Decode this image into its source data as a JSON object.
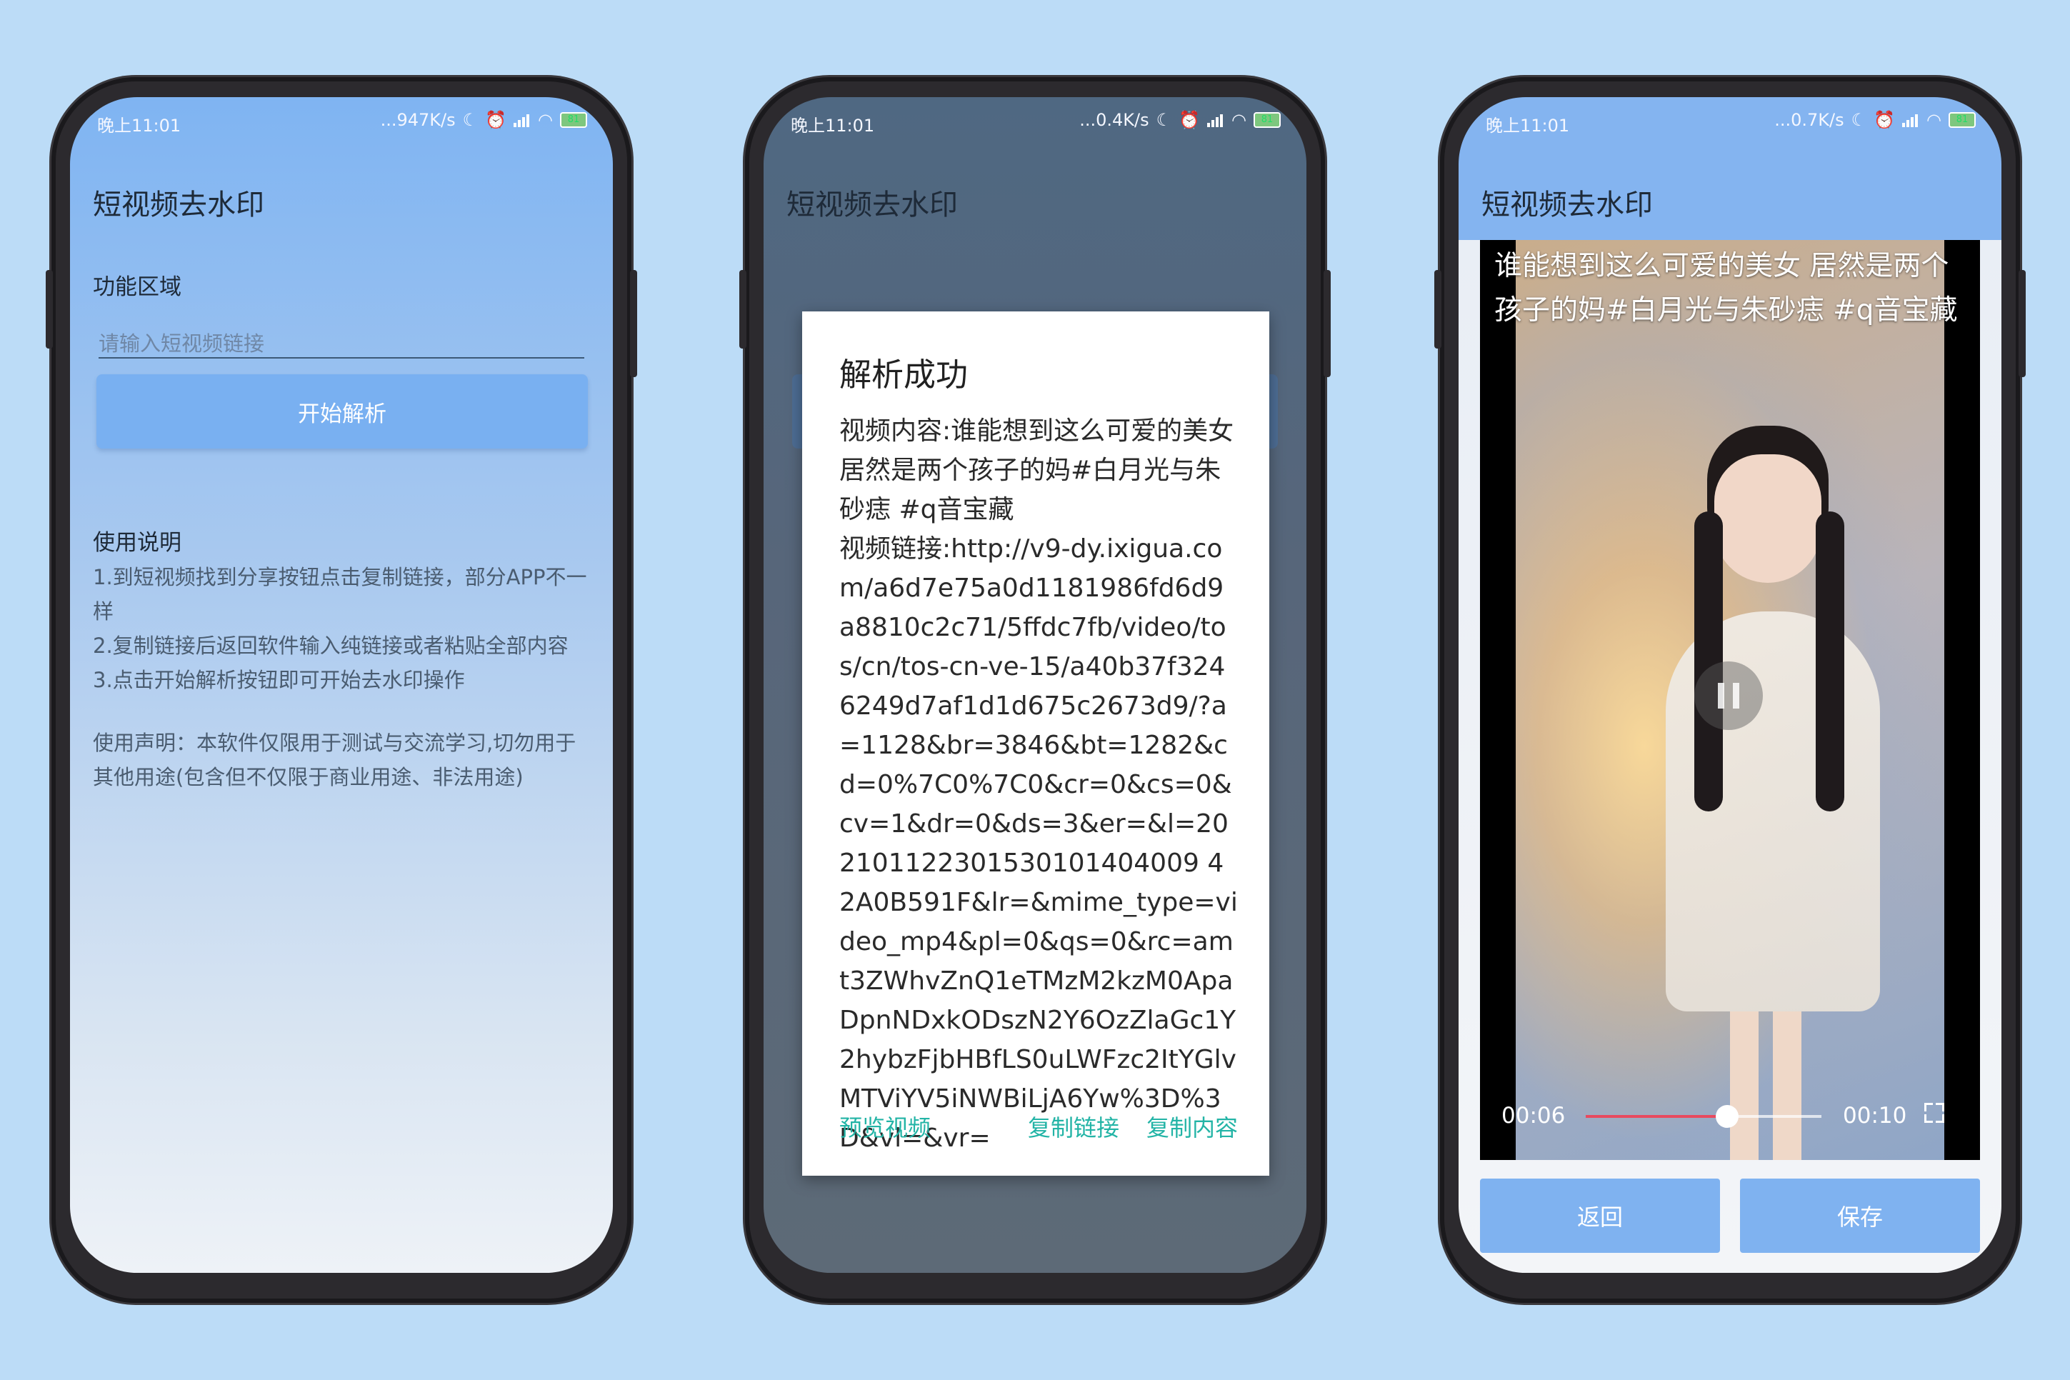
{
  "status_bar": {
    "p1": {
      "time": "晚上11:01",
      "speed": "...947K/s",
      "battery": "81"
    },
    "p2": {
      "time": "晚上11:01",
      "speed": "...0.4K/s",
      "battery": "81"
    },
    "p3": {
      "time": "晚上11:01",
      "speed": "...0.7K/s",
      "battery": "81"
    }
  },
  "app": {
    "title": "短视频去水印"
  },
  "main": {
    "feature_area_label": "功能区域",
    "link_input_placeholder": "请输入短视频链接",
    "parse_button": "开始解析",
    "usage_title": "使用说明",
    "usage_lines": [
      "1.到短视频找到分享按钮点击复制链接，部分APP不一样",
      "2.复制链接后返回软件输入纯链接或者粘贴全部内容",
      "3.点击开始解析按钮即可开始去水印操作"
    ],
    "disclaimer": "使用声明：本软件仅限用于测试与交流学习,切勿用于其他用途(包含但不仅限于商业用途、非法用途)"
  },
  "dialog": {
    "title": "解析成功",
    "body": "视频内容:谁能想到这么可爱的美女居然是两个孩子的妈#白月光与朱砂痣 #q音宝藏\n视频链接:http://v9-dy.ixigua.com/a6d7e75a0d1181986fd6d9a8810c2c71/5ffdc7fb/video/tos/cn/tos-cn-ve-15/a40b37f3246249d7af1d1d675c2673d9/?a=1128&br=3846&bt=1282&cd=0%7C0%7C0&cr=0&cs=0&cv=1&dr=0&ds=3&er=&l=202101122301530101404009 42A0B591F&lr=&mime_type=video_mp4&pl=0&qs=0&rc=amt3ZWhvZnQ1eTMzM2kzM0ApaDpnNDxkODszN2Y6OzZlaGc1Y2hybzFjbHBfLS0uLWFzc2ItYGlvMTViYV5iNWBiLjA6Yw%3D%3D&vl=&vr=",
    "preview_button": "预览视频",
    "copy_link_button": "复制链接",
    "copy_content_button": "复制内容"
  },
  "player": {
    "caption": "谁能想到这么可爱的美女 居然是两个孩子的妈#白月光与朱砂痣 #q音宝藏",
    "current_time": "00:06",
    "total_time": "00:10",
    "progress": 0.6,
    "back_button": "返回",
    "save_button": "保存"
  },
  "colors": {
    "accent": "#79b0f1",
    "dialog_action": "#23b4a6",
    "background": "#bcdcf7"
  },
  "icons": [
    "moon-icon",
    "alarm-icon",
    "signal-icon",
    "wifi-icon",
    "battery-icon",
    "pause-icon",
    "fullscreen-icon"
  ]
}
